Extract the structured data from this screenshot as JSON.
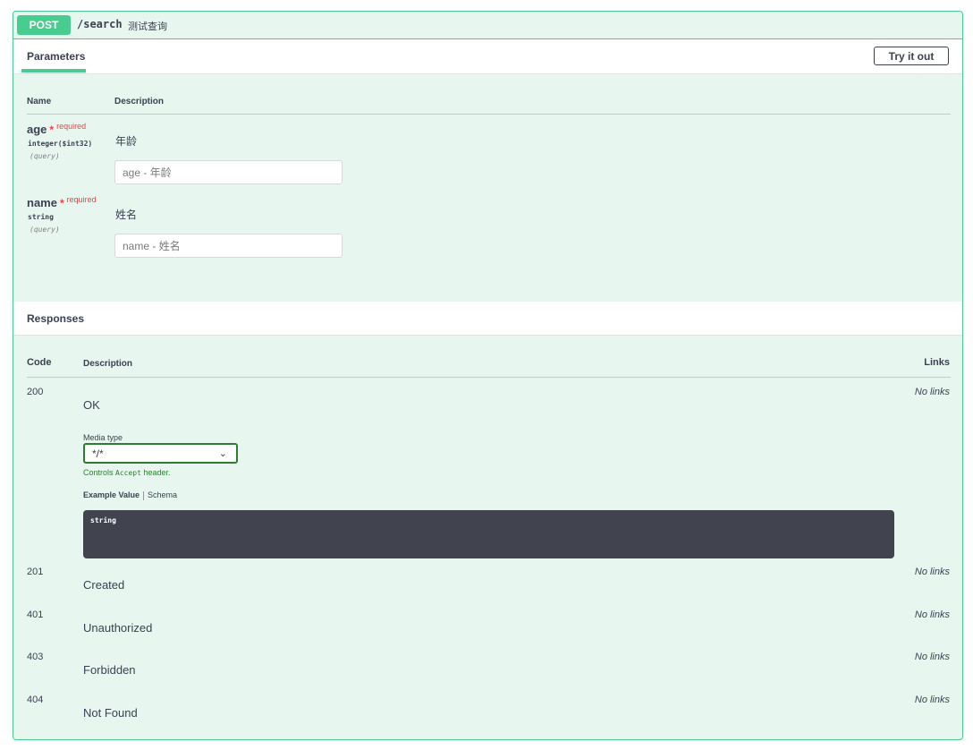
{
  "operation": {
    "method": "POST",
    "path": "/search",
    "summary": "测试查询"
  },
  "parameters": {
    "tab_label": "Parameters",
    "try_label": "Try it out",
    "col_name": "Name",
    "col_description": "Description",
    "required_text": "required",
    "items": [
      {
        "name": "age",
        "type": "integer($int32)",
        "in": "(query)",
        "description": "年龄",
        "placeholder": "age - 年龄"
      },
      {
        "name": "name",
        "type": "string",
        "in": "(query)",
        "description": "姓名",
        "placeholder": "name - 姓名"
      }
    ]
  },
  "responses": {
    "title": "Responses",
    "col_code": "Code",
    "col_description": "Description",
    "col_links": "Links",
    "media_type_label": "Media type",
    "media_type_value": "*/*",
    "controls_pre": "Controls",
    "controls_mono": "Accept",
    "controls_post": "header.",
    "example_tab": "Example Value",
    "schema_tab": "Schema",
    "example_content": "string",
    "items": [
      {
        "code": "200",
        "description": "OK",
        "links": "No links"
      },
      {
        "code": "201",
        "description": "Created",
        "links": "No links"
      },
      {
        "code": "401",
        "description": "Unauthorized",
        "links": "No links"
      },
      {
        "code": "403",
        "description": "Forbidden",
        "links": "No links"
      },
      {
        "code": "404",
        "description": "Not Found",
        "links": "No links"
      }
    ]
  },
  "colors": {
    "post_accent": "#49cc90",
    "post_background": "#e8f6f0",
    "required": "#f93e3e",
    "example_background": "#41444e"
  }
}
